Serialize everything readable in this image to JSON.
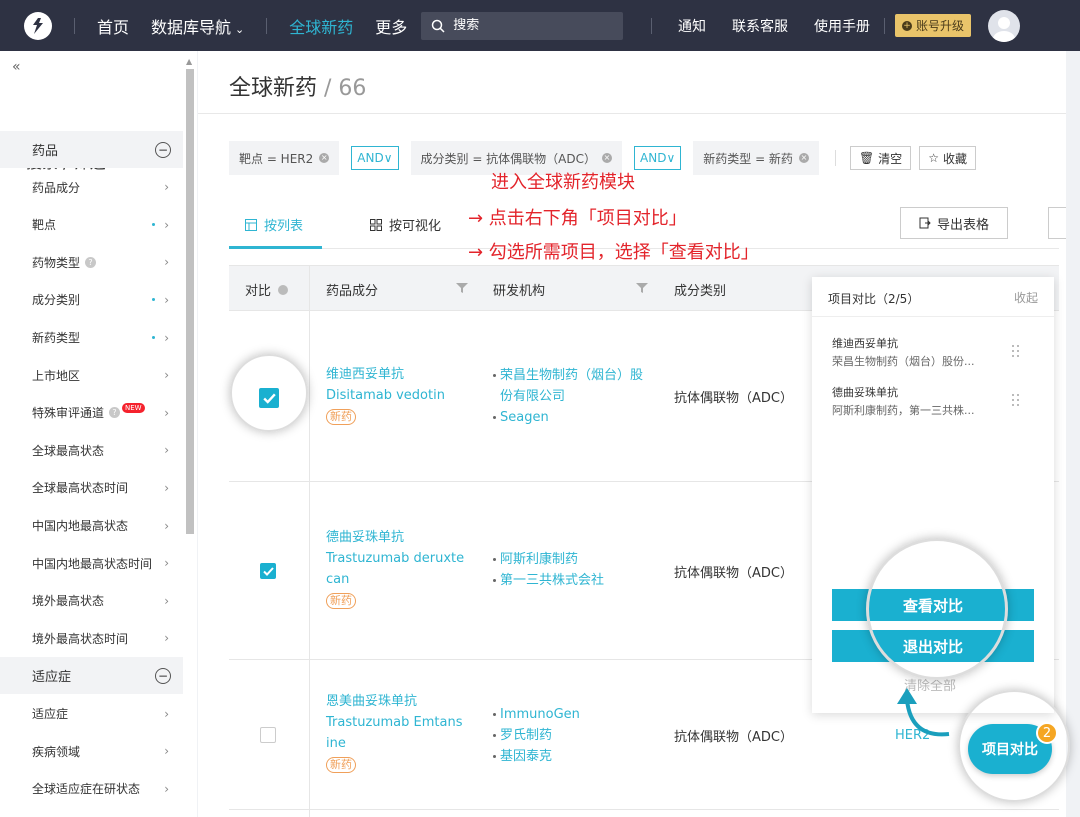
{
  "nav": {
    "items": [
      "首页",
      "数据库导航",
      "全球新药",
      "更多"
    ],
    "search_placeholder": "搜索",
    "right_links": [
      "通知",
      "联系客服",
      "使用手册"
    ],
    "upgrade": "账号升级"
  },
  "sidebar": {
    "title": "搜索 / 筛选",
    "rows": [
      {
        "label": "药品",
        "type": "group"
      },
      {
        "label": "药品成分"
      },
      {
        "label": "靶点",
        "dot": true
      },
      {
        "label": "药物类型",
        "help": true
      },
      {
        "label": "成分类别",
        "dot": true
      },
      {
        "label": "新药类型",
        "dot": true
      },
      {
        "label": "上市地区"
      },
      {
        "label": "特殊审评通道",
        "help": true,
        "badge": "NEW"
      },
      {
        "label": "全球最高状态"
      },
      {
        "label": "全球最高状态时间"
      },
      {
        "label": "中国内地最高状态"
      },
      {
        "label": "中国内地最高状态时间"
      },
      {
        "label": "境外最高状态"
      },
      {
        "label": "境外最高状态时间"
      },
      {
        "label": "适应症",
        "type": "group"
      },
      {
        "label": "适应症"
      },
      {
        "label": "疾病领域"
      },
      {
        "label": "全球适应症在研状态"
      }
    ]
  },
  "page": {
    "title": "全球新药",
    "sep": " / ",
    "count": "66"
  },
  "filters": {
    "chips": [
      "靶点 = HER2",
      "成分类别 = 抗体偶联物（ADC）",
      "新药类型 = 新药"
    ],
    "and_label": "AND",
    "clear": "清空",
    "save": "收藏"
  },
  "tabs": {
    "list": "按列表",
    "visual": "按可视化",
    "export": "导出表格"
  },
  "annotations": [
    "进入全球新药模块",
    "→ 点击右下角「项目对比」",
    "→ 勾选所需项目，选择「查看对比」"
  ],
  "table": {
    "headers": {
      "compare": "对比",
      "drug": "药品成分",
      "org": "研发机构",
      "ctype": "成分类别"
    },
    "rows": [
      {
        "checked": true,
        "cn": "维迪西妥单抗",
        "en": "Disitamab vedotin",
        "tag": "新药",
        "orgs": [
          "荣昌生物制药（烟台）股份有限公司",
          "Seagen"
        ],
        "ctype": "抗体偶联物（ADC）"
      },
      {
        "checked": true,
        "cn": "德曲妥珠单抗",
        "en": "Trastuzumab deruxtecan",
        "tag": "新药",
        "orgs": [
          "阿斯利康制药",
          "第一三共株式会社"
        ],
        "ctype": "抗体偶联物（ADC）"
      },
      {
        "checked": false,
        "cn": "恩美曲妥珠单抗",
        "en": "Trastuzumab Emtansine",
        "tag": "新药",
        "orgs": [
          "ImmunoGen",
          "罗氏制药",
          "基因泰克"
        ],
        "ctype": "抗体偶联物（ADC）",
        "target": "HER2"
      }
    ]
  },
  "compare_panel": {
    "title": "项目对比（2/5）",
    "collapse": "收起",
    "items": [
      {
        "name": "维迪西妥单抗",
        "org": "荣昌生物制药（烟台）股份..."
      },
      {
        "name": "德曲妥珠单抗",
        "org": "阿斯利康制药，第一三共株..."
      }
    ],
    "view": "查看对比",
    "exit": "退出对比",
    "clear": "清除全部"
  },
  "fab": {
    "label": "项目对比",
    "badge": "2"
  },
  "colors": {
    "accent": "#1ab0d0",
    "nav_bg": "#2e3243",
    "annotation": "#e3242b",
    "badge": "#f5a623"
  }
}
